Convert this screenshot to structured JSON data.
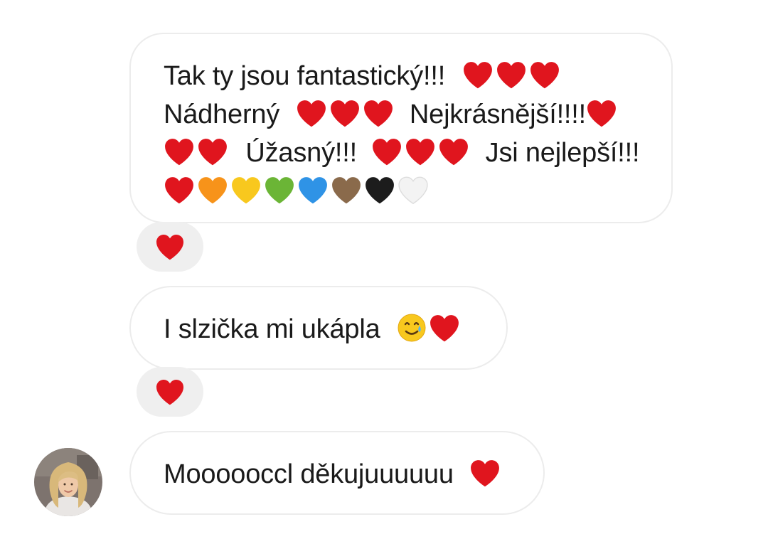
{
  "colors": {
    "bubble_border": "#ececec",
    "reaction_background": "#efefef",
    "text": "#1a1a1a",
    "heart_red": "#e0151e",
    "heart_orange": "#f7931a",
    "heart_yellow": "#f8c81e",
    "heart_green": "#6bb536",
    "heart_blue": "#2f93e6",
    "heart_brown": "#8a6a4b",
    "heart_black": "#1c1c1c",
    "heart_white": "#f3f3f3"
  },
  "messages": [
    {
      "lines": [
        {
          "text_1": "Tak ty jsou fantastický!!!",
          "emojis": [
            "red-heart",
            "red-heart",
            "red-heart"
          ]
        },
        {
          "text_1": "Nádherný",
          "emojis_1": [
            "red-heart",
            "red-heart",
            "red-heart"
          ],
          "text_2": "Nejkrásnější!!!!",
          "emojis_2": [
            "red-heart"
          ]
        },
        {
          "emojis_1": [
            "red-heart",
            "red-heart"
          ],
          "text_1": "Úžasný!!!",
          "emojis_2": [
            "red-heart",
            "red-heart",
            "red-heart"
          ],
          "text_2": "Jsi nejlepší!!!"
        },
        {
          "emojis": [
            "red-heart",
            "orange-heart",
            "yellow-heart",
            "green-heart",
            "blue-heart",
            "brown-heart",
            "black-heart",
            "white-heart"
          ]
        }
      ],
      "reaction": "red-heart"
    },
    {
      "text": "I slzička mi ukápla",
      "emojis": [
        "smiling-face-with-tear",
        "red-heart"
      ],
      "reaction": "red-heart"
    },
    {
      "text": "Moooooccl děkujuuuuuu",
      "emojis": [
        "red-heart"
      ],
      "sender_avatar": "avatar-photo"
    }
  ]
}
